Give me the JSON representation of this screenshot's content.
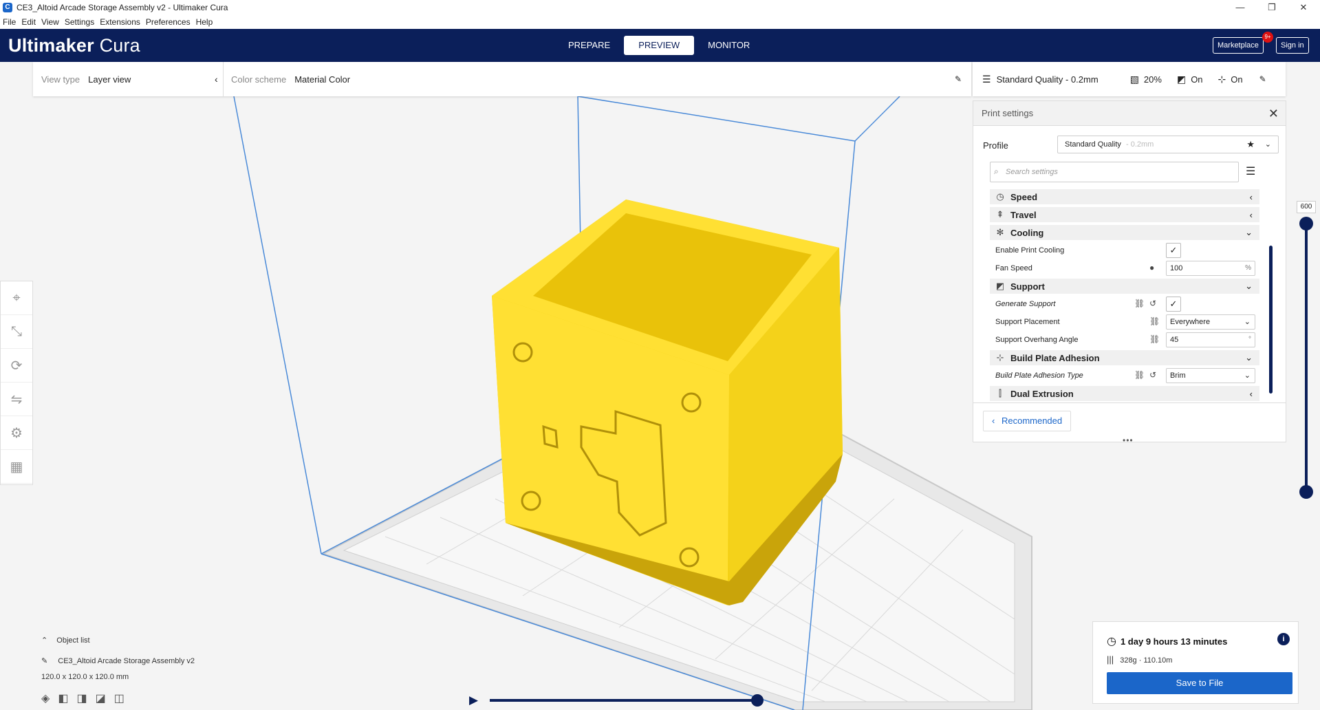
{
  "window": {
    "title": "CE3_Altoid Arcade Storage Assembly v2 - Ultimaker Cura",
    "minimize": "—",
    "maximize": "❐",
    "close": "✕"
  },
  "menu": [
    "File",
    "Edit",
    "View",
    "Settings",
    "Extensions",
    "Preferences",
    "Help"
  ],
  "header": {
    "logo_bold": "Ultimaker",
    "logo_thin": "Cura",
    "tabs": [
      "PREPARE",
      "PREVIEW",
      "MONITOR"
    ],
    "active_tab": "PREVIEW",
    "marketplace": "Marketplace",
    "marketplace_badge": "9+",
    "sign_in": "Sign in"
  },
  "view_toolbar": {
    "view_type_label": "View type",
    "view_type_value": "Layer view",
    "color_scheme_label": "Color scheme",
    "color_scheme_value": "Material Color"
  },
  "quick_settings": {
    "quality": "Standard Quality - 0.2mm",
    "infill": "20%",
    "support": "On",
    "adhesion": "On"
  },
  "print_settings": {
    "title": "Print settings",
    "profile_label": "Profile",
    "profile_value": "Standard Quality",
    "profile_suffix": "- 0.2mm",
    "search_placeholder": "Search settings",
    "categories": {
      "speed": "Speed",
      "travel": "Travel",
      "cooling": "Cooling",
      "support": "Support",
      "adhesion": "Build Plate Adhesion",
      "dual": "Dual Extrusion"
    },
    "settings": {
      "enable_cooling": "Enable Print Cooling",
      "fan_speed": "Fan Speed",
      "fan_speed_value": "100",
      "fan_speed_unit": "%",
      "generate_support": "Generate Support",
      "support_placement": "Support Placement",
      "support_placement_value": "Everywhere",
      "overhang_angle": "Support Overhang Angle",
      "overhang_angle_value": "45",
      "overhang_angle_unit": "°",
      "adhesion_type": "Build Plate Adhesion Type",
      "adhesion_type_value": "Brim"
    },
    "recommended": "Recommended"
  },
  "layer_slider": {
    "value": "600"
  },
  "object_list": {
    "header": "Object list",
    "object_name": "CE3_Altoid Arcade Storage Assembly v2",
    "dimensions": "120.0 x 120.0 x 120.0 mm"
  },
  "estimate": {
    "time": "1 day 9 hours 13 minutes",
    "material": "328g · 110.10m",
    "save": "Save to File"
  },
  "colors": {
    "brand": "#0b1f5a",
    "accent": "#1b66c9",
    "model": "#ffe033"
  }
}
